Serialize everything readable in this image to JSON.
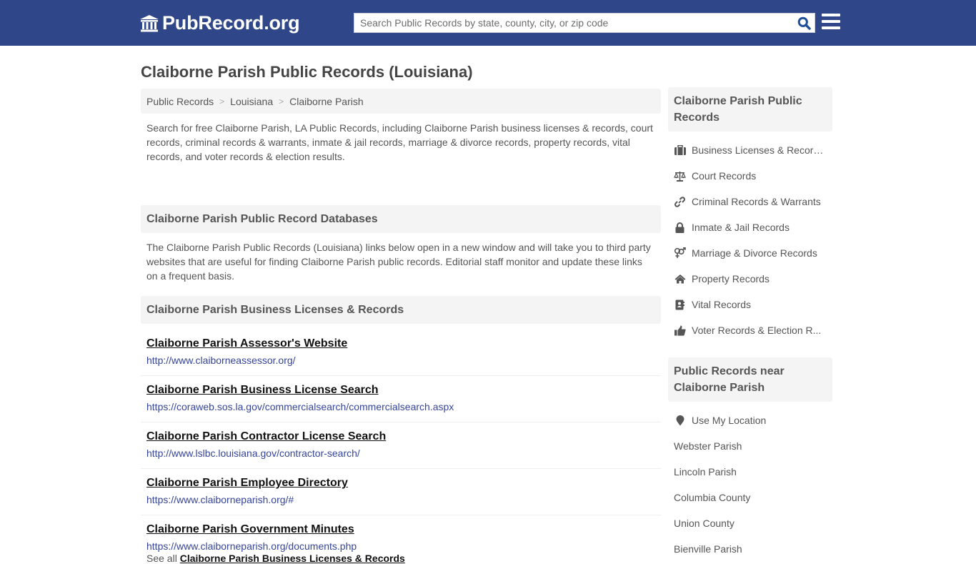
{
  "header": {
    "logo_text": "PubRecord.org",
    "search_placeholder": "Search Public Records by state, county, city, or zip code",
    "colors": {
      "brand": "#2f4689",
      "search_icon": "#1f4f9a"
    }
  },
  "page": {
    "title": "Claiborne Parish Public Records (Louisiana)"
  },
  "breadcrumb": [
    {
      "label": "Public Records"
    },
    {
      "label": "Louisiana"
    },
    {
      "label": "Claiborne Parish"
    }
  ],
  "breadcrumb_separator": ">",
  "intro": "Search for free Claiborne Parish, LA Public Records, including Claiborne Parish business licenses & records, court records, criminal records & warrants, inmate & jail records, marriage & divorce records, property records, vital records, and voter records & election results.",
  "databases": {
    "heading": "Claiborne Parish Public Record Databases",
    "text": "The Claiborne Parish Public Records (Louisiana) links below open in a new window and will take you to third party websites that are useful for finding Claiborne Parish public records. Editorial staff monitor and update these links on a frequent basis."
  },
  "business": {
    "heading": "Claiborne Parish Business Licenses & Records",
    "links": [
      {
        "title": "Claiborne Parish Assessor's Website",
        "url": "http://www.claiborneassessor.org/"
      },
      {
        "title": "Claiborne Parish Business License Search",
        "url": "https://coraweb.sos.la.gov/commercialsearch/commercialsearch.aspx"
      },
      {
        "title": "Claiborne Parish Contractor License Search",
        "url": "http://www.lslbc.louisiana.gov/contractor-search/"
      },
      {
        "title": "Claiborne Parish Employee Directory",
        "url": "https://www.claiborneparish.org/#"
      },
      {
        "title": "Claiborne Parish Government Minutes",
        "url": "https://www.claiborneparish.org/documents.php"
      }
    ],
    "see_all_prefix": "See all",
    "see_all_link": "Claiborne Parish Business Licenses & Records"
  },
  "sidebar": {
    "records_heading": "Claiborne Parish Public Records",
    "records": [
      {
        "label": "Business Licenses & Records",
        "icon": "briefcase-icon"
      },
      {
        "label": "Court Records",
        "icon": "scale-icon"
      },
      {
        "label": "Criminal Records & Warrants",
        "icon": "link-icon"
      },
      {
        "label": "Inmate & Jail Records",
        "icon": "lock-icon"
      },
      {
        "label": "Marriage & Divorce Records",
        "icon": "gender-icon"
      },
      {
        "label": "Property Records",
        "icon": "home-icon"
      },
      {
        "label": "Vital Records",
        "icon": "contact-book-icon"
      },
      {
        "label": "Voter Records & Election R...",
        "icon": "thumbs-up-icon"
      }
    ],
    "near_heading": "Public Records near Claiborne Parish",
    "use_location": "Use My Location",
    "near": [
      {
        "label": "Webster Parish"
      },
      {
        "label": "Lincoln Parish"
      },
      {
        "label": "Columbia County"
      },
      {
        "label": "Union County"
      },
      {
        "label": "Bienville Parish"
      }
    ]
  }
}
